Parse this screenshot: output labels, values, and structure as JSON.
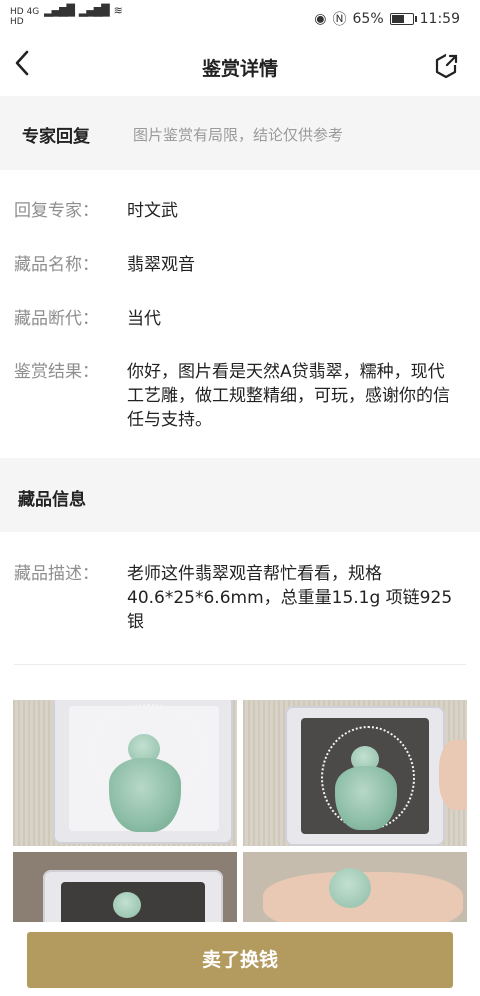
{
  "status_bar": {
    "left_labels": [
      "HD",
      "4G",
      "HD",
      "4G"
    ],
    "battery_percent": "65%",
    "battery_level": 0.65,
    "time": "11:59",
    "icons": [
      "eye-icon",
      "nfc-icon",
      "battery-icon",
      "wifi-icon",
      "signal-icon"
    ]
  },
  "header": {
    "title": "鉴赏详情",
    "back_icon": "chevron-left-icon",
    "share_icon": "share-icon"
  },
  "expert_reply": {
    "section_title": "专家回复",
    "disclaimer": "图片鉴赏有局限，结论仅供参考",
    "fields": [
      {
        "label": "回复专家：",
        "value": "时文武"
      },
      {
        "label": "藏品名称：",
        "value": "翡翠观音"
      },
      {
        "label": "藏品断代：",
        "value": "当代"
      },
      {
        "label": "鉴赏结果：",
        "value": "你好，图片看是天然A贷翡翠，糯种，现代工艺雕，做工规整精细，可玩，感谢你的信任与支持。"
      }
    ]
  },
  "collection_info": {
    "section_title": "藏品信息",
    "description_label": "藏品描述：",
    "description": "老师这件翡翠观音帮忙看看，规格40.6*25*6.6mm，总重量15.1g 项链925银"
  },
  "photos": [
    "jade-guanyin-pendant-photo-1",
    "jade-guanyin-pendant-photo-2",
    "jade-guanyin-pendant-photo-3",
    "jade-guanyin-pendant-photo-4"
  ],
  "footer": {
    "sell_button": "卖了换钱"
  },
  "colors": {
    "accent_gold": "#b39a5f",
    "band_gray": "#f5f5f5",
    "label_gray": "#8e8e8e"
  }
}
